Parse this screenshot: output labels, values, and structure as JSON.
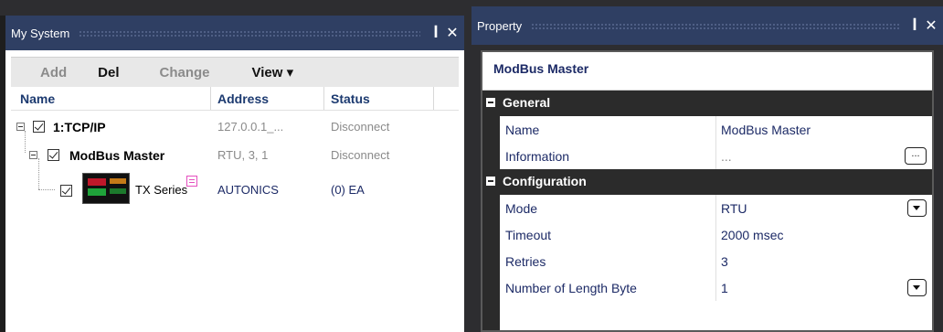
{
  "my_system": {
    "title": "My System",
    "pin": "ꟾ",
    "close": "✕",
    "toolbar": {
      "add": "Add",
      "del": "Del",
      "change": "Change",
      "view": "View ▾"
    },
    "columns": {
      "name": "Name",
      "address": "Address",
      "status": "Status"
    },
    "tree": [
      {
        "name": "1:TCP/IP",
        "address": "127.0.0.1_...",
        "status": "Disconnect"
      },
      {
        "name": "ModBus Master",
        "address": "RTU, 3, 1",
        "status": "Disconnect"
      },
      {
        "name": "TX Series",
        "address": "AUTONICS",
        "status": "(0) EA"
      }
    ]
  },
  "property": {
    "title": "Property",
    "pin": "ꟾ",
    "close": "✕",
    "object_name": "ModBus Master",
    "categories": [
      {
        "label": "General",
        "rows": [
          {
            "name": "Name",
            "value": "ModBus Master"
          },
          {
            "name": "Information",
            "value": "...",
            "button": "..."
          }
        ]
      },
      {
        "label": "Configuration",
        "rows": [
          {
            "name": "Mode",
            "value": "RTU"
          },
          {
            "name": "Timeout",
            "value": "2000 msec"
          },
          {
            "name": "Retries",
            "value": "3"
          },
          {
            "name": "Number of Length Byte",
            "value": "1"
          }
        ]
      }
    ]
  }
}
